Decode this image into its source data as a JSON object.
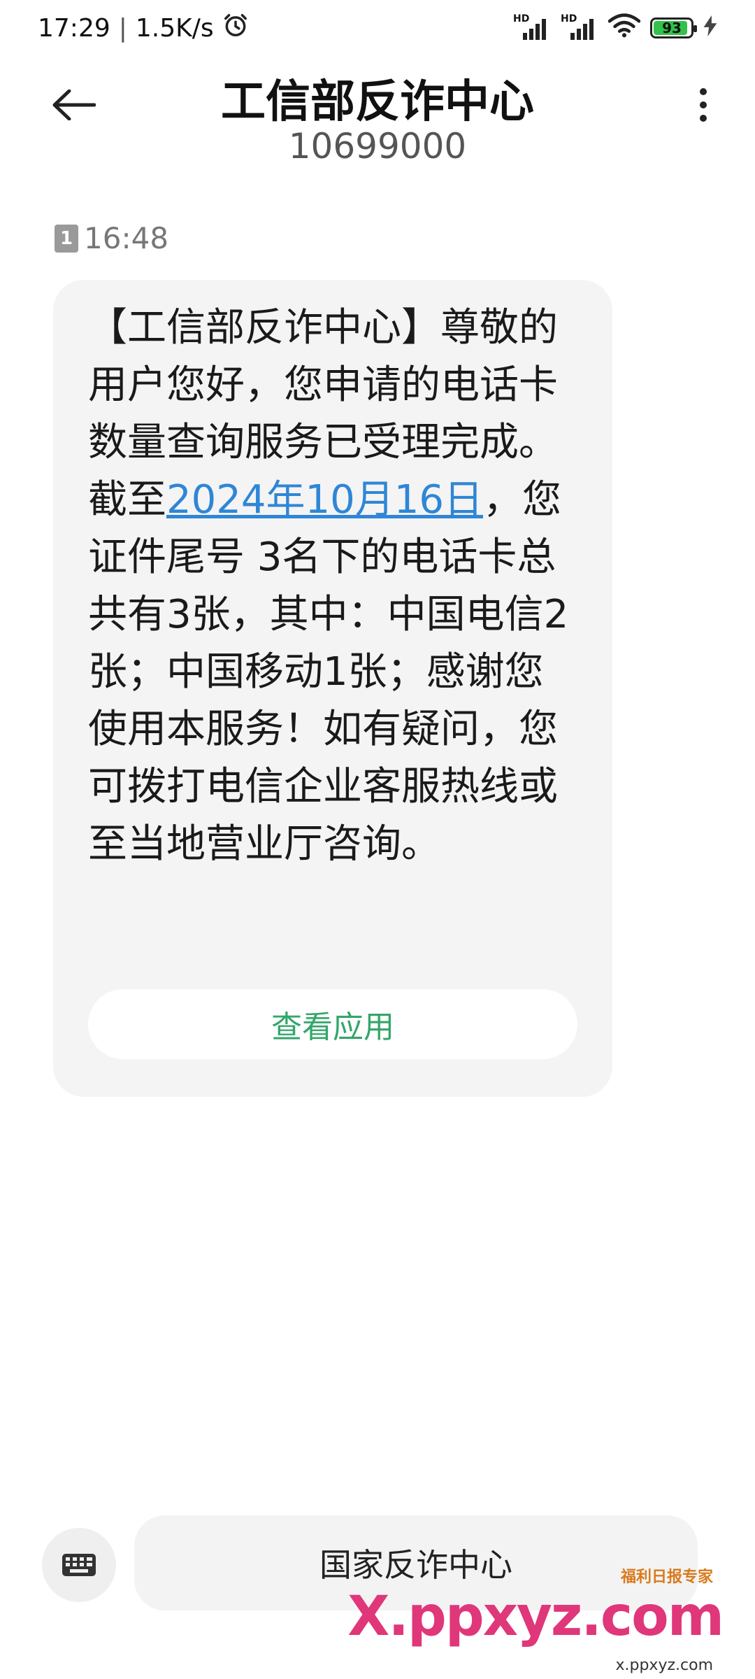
{
  "status_bar": {
    "time": "17:29",
    "speed": "1.5K/s",
    "signal_1_label": "HD",
    "signal_2_label": "HD",
    "battery_level": "93",
    "battery_fraction": 0.93
  },
  "header": {
    "title": "工信部反诈中心",
    "number": "10699000"
  },
  "message": {
    "sim_slot": "1",
    "time": "16:48",
    "text_before_link": "【工信部反诈中心】尊敬的用户您好，您申请的电话卡数量查询服务已受理完成。截至",
    "link_text": "2024年10月16日",
    "text_after_link": "，您证件尾号  3名下的电话卡总共有3张，其中：中国电信2张；中国移动1张；感谢您使用本服务！如有疑问，您可拨打电信企业客服热线或至当地营业厅咨询。",
    "view_app_label": "查看应用"
  },
  "reply_bar": {
    "label": "国家反诈中心"
  },
  "watermark": {
    "main": "X.ppxyz.com",
    "badge": "福利日报专家",
    "sub": "x.ppxyz.com"
  },
  "colors": {
    "link": "#2f86d6",
    "button_text": "#33a66a",
    "battery": "#31c24a",
    "bubble": "#f4f4f4"
  },
  "icons": {
    "back": "arrow-left-icon",
    "more": "more-vertical-icon",
    "keyboard": "keyboard-icon",
    "alarm": "alarm-clock-icon",
    "wifi": "wifi-icon",
    "charging": "charging-bolt-icon"
  }
}
